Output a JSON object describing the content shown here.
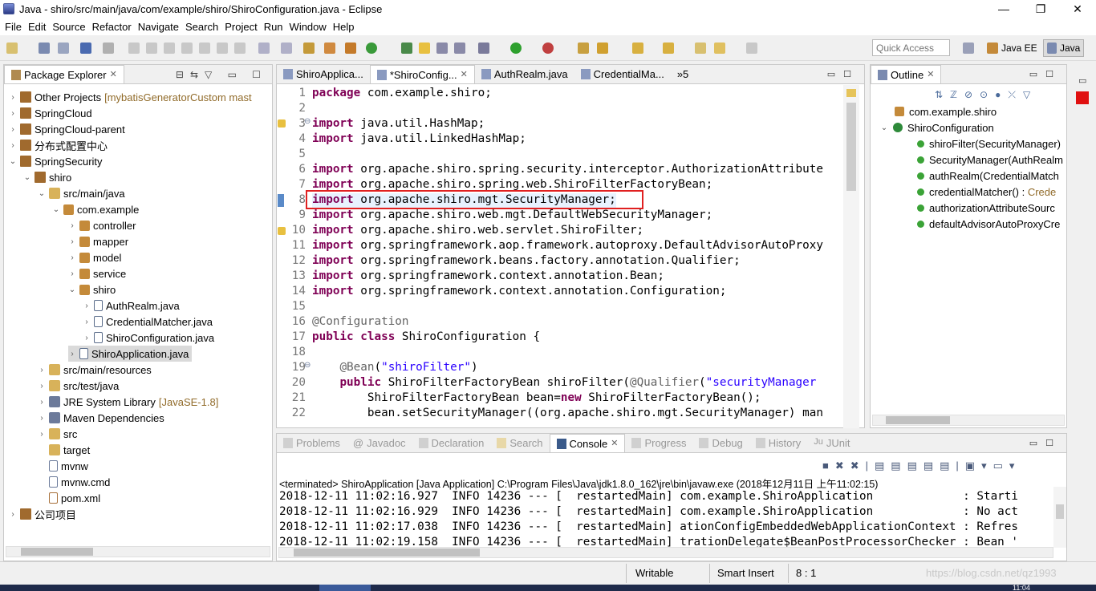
{
  "window": {
    "title": "Java - shiro/src/main/java/com/example/shiro/ShiroConfiguration.java - Eclipse",
    "controls": [
      "—",
      "❐",
      "✕"
    ]
  },
  "menu": [
    "File",
    "Edit",
    "Source",
    "Refactor",
    "Navigate",
    "Search",
    "Project",
    "Run",
    "Window",
    "Help"
  ],
  "toolbar": {
    "quick_access_placeholder": "Quick Access",
    "perspectives": [
      "Java EE",
      "Java"
    ]
  },
  "package_explorer": {
    "title": "Package Explorer",
    "items": [
      {
        "label": "Other Projects",
        "decor": "[mybatisGeneratorCustom mast"
      },
      {
        "label": "SpringCloud"
      },
      {
        "label": "SpringCloud-parent"
      },
      {
        "label": "分布式配置中心"
      },
      {
        "label": "SpringSecurity"
      },
      {
        "label": "shiro"
      },
      {
        "label": "src/main/java"
      },
      {
        "label": "com.example"
      },
      {
        "label": "controller"
      },
      {
        "label": "mapper"
      },
      {
        "label": "model"
      },
      {
        "label": "service"
      },
      {
        "label": "shiro"
      },
      {
        "label": "AuthRealm.java"
      },
      {
        "label": "CredentialMatcher.java"
      },
      {
        "label": "ShiroConfiguration.java"
      },
      {
        "label": "ShiroApplication.java"
      },
      {
        "label": "src/main/resources"
      },
      {
        "label": "src/test/java"
      },
      {
        "label": "JRE System Library",
        "decor": "[JavaSE-1.8]"
      },
      {
        "label": "Maven Dependencies"
      },
      {
        "label": "src"
      },
      {
        "label": "target"
      },
      {
        "label": "mvnw"
      },
      {
        "label": "mvnw.cmd"
      },
      {
        "label": "pom.xml"
      },
      {
        "label": "公司项目"
      }
    ]
  },
  "editor": {
    "tabs": [
      "ShiroApplica...",
      "*ShiroConfig...",
      "AuthRealm.java",
      "CredentialMa...",
      "»5"
    ],
    "line_numbers": [
      "1",
      "2",
      "3",
      "4",
      "5",
      "6",
      "7",
      "8",
      "9",
      "10",
      "11",
      "12",
      "13",
      "14",
      "15",
      "16",
      "17",
      "18",
      "19",
      "20",
      "21",
      "22"
    ],
    "lines": [
      [
        [
          "kw",
          "package"
        ],
        [
          "t",
          " com.example.shiro;"
        ]
      ],
      [],
      [
        [
          "kw",
          "import"
        ],
        [
          "t",
          " java.util.HashMap;"
        ]
      ],
      [
        [
          "kw",
          "import"
        ],
        [
          "t",
          " java.util.LinkedHashMap;"
        ]
      ],
      [],
      [
        [
          "kw",
          "import"
        ],
        [
          "t",
          " org.apache.shiro.spring.security.interceptor.AuthorizationAttribute"
        ]
      ],
      [
        [
          "kw",
          "import"
        ],
        [
          "t",
          " org.apache.shiro.spring.web.ShiroFilterFactoryBean;"
        ]
      ],
      [
        [
          "kw",
          "import"
        ],
        [
          "t",
          " org.apache.shiro.mgt.SecurityManager;"
        ]
      ],
      [
        [
          "kw",
          "import"
        ],
        [
          "t",
          " org.apache.shiro.web.mgt.DefaultWebSecurityManager;"
        ]
      ],
      [
        [
          "kw",
          "import"
        ],
        [
          "t",
          " org.apache.shiro.web.servlet.ShiroFilter;"
        ]
      ],
      [
        [
          "kw",
          "import"
        ],
        [
          "t",
          " org.springframework.aop.framework.autoproxy.DefaultAdvisorAutoProxy"
        ]
      ],
      [
        [
          "kw",
          "import"
        ],
        [
          "t",
          " org.springframework.beans.factory.annotation.Qualifier;"
        ]
      ],
      [
        [
          "kw",
          "import"
        ],
        [
          "t",
          " org.springframework.context.annotation.Bean;"
        ]
      ],
      [
        [
          "kw",
          "import"
        ],
        [
          "t",
          " org.springframework.context.annotation.Configuration;"
        ]
      ],
      [],
      [
        [
          "ann",
          "@Configuration"
        ]
      ],
      [
        [
          "kw",
          "public"
        ],
        [
          "t",
          " "
        ],
        [
          "kw",
          "class"
        ],
        [
          "t",
          " ShiroConfiguration {"
        ]
      ],
      [],
      [
        [
          "t",
          "    "
        ],
        [
          "ann",
          "@Bean"
        ],
        [
          "t",
          "("
        ],
        [
          "str",
          "\"shiroFilter\""
        ],
        [
          "t",
          ")"
        ]
      ],
      [
        [
          "t",
          "    "
        ],
        [
          "kw",
          "public"
        ],
        [
          "t",
          " ShiroFilterFactoryBean shiroFilter("
        ],
        [
          "ann",
          "@Qualifier"
        ],
        [
          "t",
          "("
        ],
        [
          "str",
          "\"securityManager"
        ]
      ],
      [
        [
          "t",
          "        ShiroFilterFactoryBean bean="
        ],
        [
          "kw",
          "new"
        ],
        [
          "t",
          " ShiroFilterFactoryBean();"
        ]
      ],
      [
        [
          "t",
          "        bean.setSecurityManager((org.apache.shiro.mgt.SecurityManager) man"
        ]
      ]
    ]
  },
  "outline": {
    "title": "Outline",
    "items": [
      {
        "label": "com.example.shiro"
      },
      {
        "label": "ShiroConfiguration"
      },
      {
        "label": "shiroFilter(SecurityManager)"
      },
      {
        "label": "SecurityManager(AuthRealm"
      },
      {
        "label": "authRealm(CredentialMatch"
      },
      {
        "label": "credentialMatcher() : ",
        "decor": "Crede"
      },
      {
        "label": "authorizationAttributeSourc"
      },
      {
        "label": "defaultAdvisorAutoProxyCre"
      }
    ]
  },
  "bottom": {
    "tabs": [
      "Problems",
      "Javadoc",
      "Declaration",
      "Search",
      "Console",
      "Progress",
      "Debug",
      "History",
      "JUnit"
    ],
    "console_header": "<terminated> ShiroApplication [Java Application] C:\\Program Files\\Java\\jdk1.8.0_162\\jre\\bin\\javaw.exe (2018年12月11日 上午11:02:15)",
    "console_lines": [
      "2018-12-11 11:02:16.927  INFO 14236 --- [  restartedMain] com.example.ShiroApplication             : Starti",
      "2018-12-11 11:02:16.929  INFO 14236 --- [  restartedMain] com.example.ShiroApplication             : No act",
      "2018-12-11 11:02:17.038  INFO 14236 --- [  restartedMain] ationConfigEmbeddedWebApplicationContext : Refres",
      "2018-12-11 11:02:19.158  INFO 14236 --- [  restartedMain] trationDelegate$BeanPostProcessorChecker : Bean '"
    ]
  },
  "statusbar": {
    "mode": "Writable",
    "insert": "Smart Insert",
    "position": "8 : 1",
    "watermark": "https://blog.csdn.net/qz1993",
    "clock": "11:04"
  },
  "colors": {
    "keyword": "#7f0055",
    "string": "#2a00ff",
    "highlight_box": "#e02020"
  }
}
